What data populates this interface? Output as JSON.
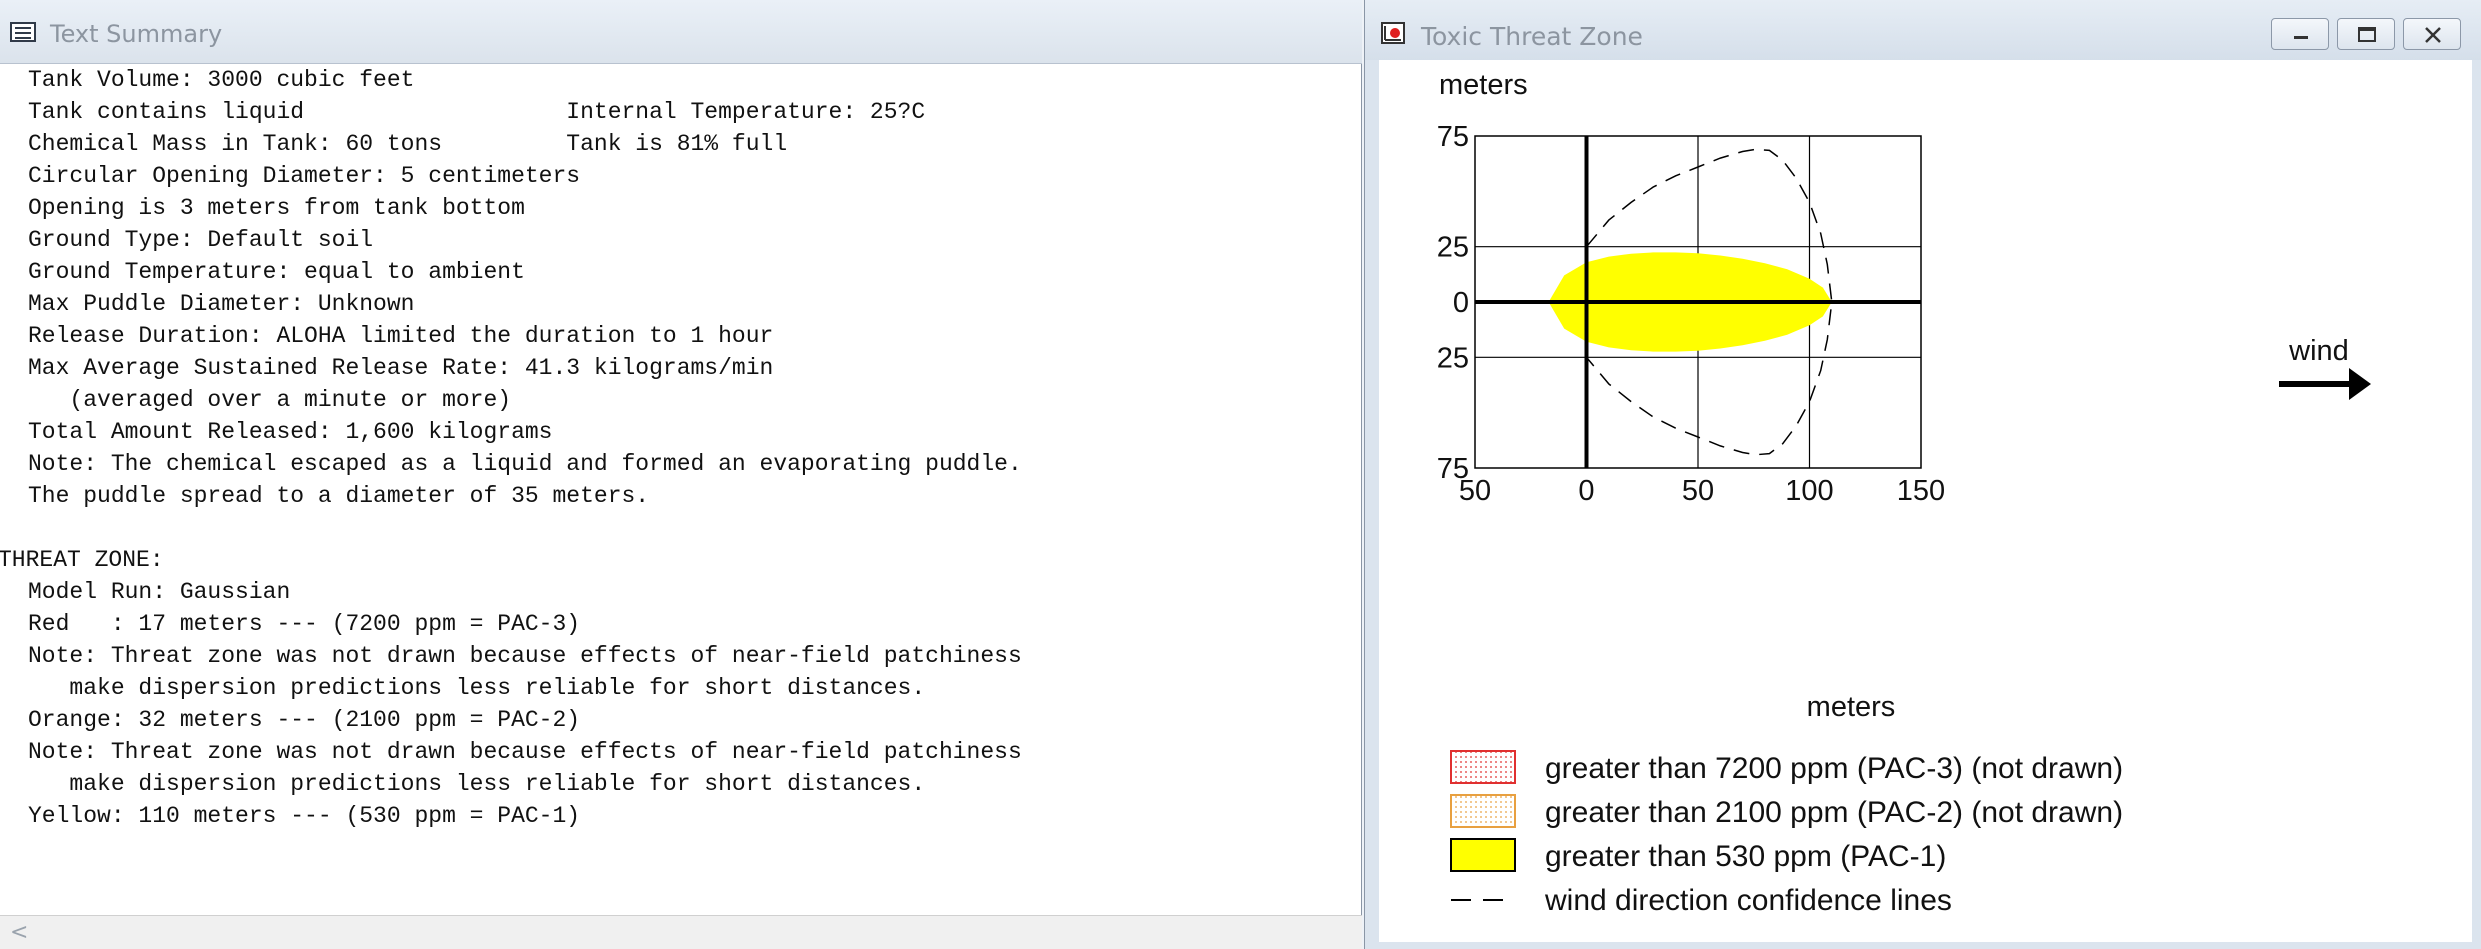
{
  "text_window": {
    "title": "Text Summary",
    "lines": [
      "Tank Volume: 3000 cubic feet",
      "Tank contains liquid                   Internal Temperature: 25?C",
      "Chemical Mass in Tank: 60 tons         Tank is 81% full",
      "Circular Opening Diameter: 5 centimeters",
      "Opening is 3 meters from tank bottom",
      "Ground Type: Default soil",
      "Ground Temperature: equal to ambient",
      "Max Puddle Diameter: Unknown",
      "Release Duration: ALOHA limited the duration to 1 hour",
      "Max Average Sustained Release Rate: 41.3 kilograms/min",
      "   (averaged over a minute or more)",
      "Total Amount Released: 1,600 kilograms",
      "Note: The chemical escaped as a liquid and formed an evaporating puddle.",
      "The puddle spread to a diameter of 35 meters.",
      "",
      "THREAT ZONE:",
      "Model Run: Gaussian",
      "Red   : 17 meters --- (7200 ppm = PAC-3)",
      "Note: Threat zone was not drawn because effects of near-field patchiness",
      "   make dispersion predictions less reliable for short distances.",
      "Orange: 32 meters --- (2100 ppm = PAC-2)",
      "Note: Threat zone was not drawn because effects of near-field patchiness",
      "   make dispersion predictions less reliable for short distances.",
      "Yellow: 110 meters --- (530 ppm = PAC-1)"
    ],
    "scroll_left_glyph": "<"
  },
  "plot_window": {
    "title": "Toxic Threat Zone",
    "ylabel": "meters",
    "xlabel": "meters",
    "wind_label": "wind",
    "colors": {
      "yellow": "#ffff00",
      "red": "#e03030",
      "orange": "#e8a040",
      "grid": "#000000"
    },
    "icons": {
      "window": "threat-zone-icon",
      "min": "minimize-icon",
      "max": "maximize-icon",
      "close": "close-icon"
    },
    "legend": [
      {
        "swatch": "red-dotted",
        "label": "greater than 7200 ppm (PAC-3) (not drawn)"
      },
      {
        "swatch": "orange-dotted",
        "label": "greater than 2100 ppm (PAC-2) (not drawn)"
      },
      {
        "swatch": "yellow-solid",
        "label": "greater than 530 ppm (PAC-1)"
      },
      {
        "swatch": "dashed-line",
        "label": "wind direction confidence lines"
      }
    ]
  },
  "chart_data": {
    "type": "area",
    "xlim": [
      -50,
      150
    ],
    "ylim": [
      -75,
      75
    ],
    "x_ticks": [
      {
        "value": -50,
        "label": "50"
      },
      {
        "value": 0,
        "label": "0"
      },
      {
        "value": 50,
        "label": "50"
      },
      {
        "value": 100,
        "label": "100"
      },
      {
        "value": 150,
        "label": "150"
      }
    ],
    "y_ticks": [
      {
        "value": 75,
        "label": "75"
      },
      {
        "value": 25,
        "label": "25"
      },
      {
        "value": 0,
        "label": "0"
      },
      {
        "value": -25,
        "label": "25"
      },
      {
        "value": -75,
        "label": "75"
      }
    ],
    "grid": true,
    "threat_zone": {
      "name": "greater than 530 ppm (PAC-1)",
      "x": [
        -17,
        -10,
        0,
        10,
        20,
        30,
        40,
        50,
        60,
        70,
        80,
        90,
        100,
        106,
        110
      ],
      "y_upper": [
        0,
        12,
        18,
        20.5,
        21.8,
        22.4,
        22.4,
        22,
        21,
        19.5,
        17.5,
        14.8,
        10.5,
        6.5,
        0
      ]
    },
    "confidence_lines": {
      "name": "wind direction confidence lines",
      "x": [
        0,
        10,
        20,
        30,
        40,
        50,
        60,
        70,
        76,
        82,
        88,
        94,
        100,
        105,
        108,
        110
      ],
      "y_upper": [
        25,
        37,
        45,
        52,
        57,
        61,
        65,
        68,
        69,
        68.5,
        64,
        56,
        45,
        31,
        17,
        0
      ]
    }
  }
}
